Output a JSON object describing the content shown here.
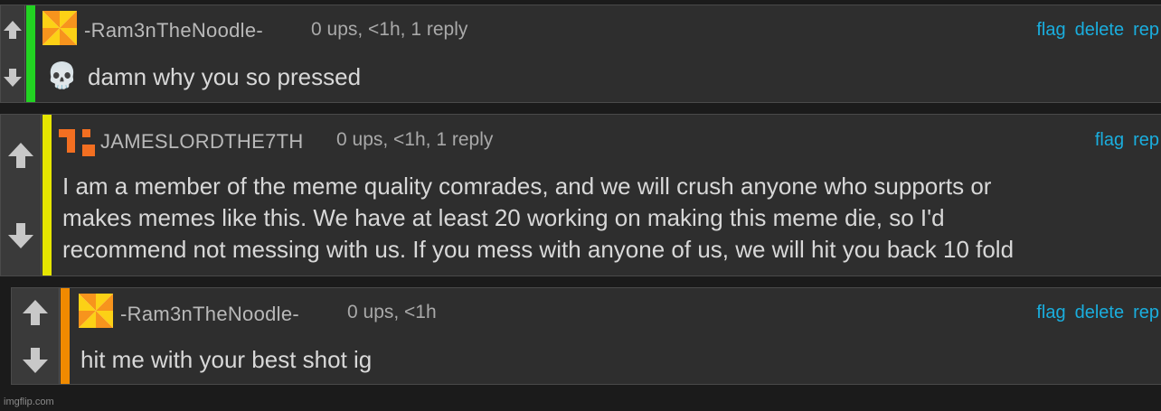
{
  "comments": [
    {
      "username": "-Ram3nTheNoodle-",
      "meta": "0 ups, <1h, 1 reply",
      "actions": [
        "flag",
        "delete",
        "rep"
      ],
      "emoji": "💀",
      "body": "damn why you so pressed",
      "bar_color": "#22d322"
    },
    {
      "username": "JAMESLORDTHE7TH",
      "meta": "0 ups, <1h, 1 reply",
      "actions": [
        "flag",
        "rep"
      ],
      "body_lines": [
        "I am a member of the meme quality comrades, and we will crush anyone who supports or",
        "makes memes like this. We have at least 20 working on making this meme die, so I'd",
        "recommend not messing with us. If you mess with anyone of us, we will hit you back 10 fold"
      ],
      "bar_color": "#e6e600"
    },
    {
      "username": "-Ram3nTheNoodle-",
      "meta": "0 ups, <1h",
      "actions": [
        "flag",
        "delete",
        "rep"
      ],
      "body": "hit me with your best shot ig",
      "bar_color": "#f08a00"
    }
  ],
  "watermark": "imgflip.com",
  "colors": {
    "link": "#1aaede",
    "background": "#1b1b1b",
    "panel": "#2e2e2e"
  }
}
